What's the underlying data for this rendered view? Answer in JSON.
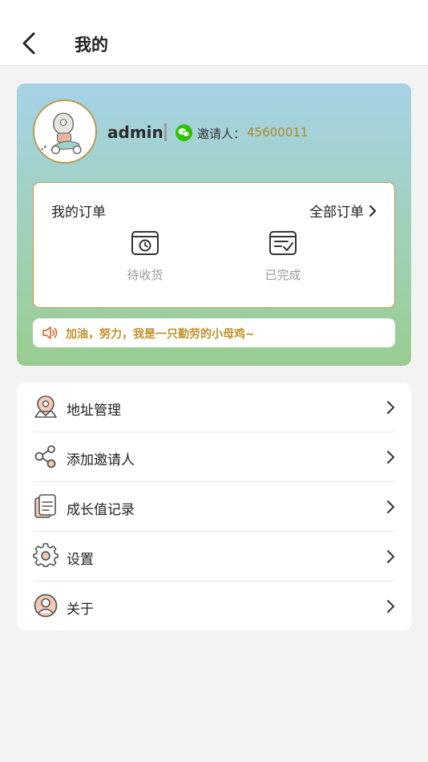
{
  "header": {
    "title": "我的"
  },
  "profile": {
    "username": "admin",
    "inviter_label": "邀请人：",
    "inviter_id": "45600011"
  },
  "orders": {
    "title": "我的订单",
    "all_label": "全部订单",
    "items": [
      {
        "label": "待收货",
        "icon": "package-clock-icon"
      },
      {
        "label": "已完成",
        "icon": "completed-list-icon"
      }
    ]
  },
  "notice": {
    "text": "加油，努力，我是一只勤劳的小母鸡~"
  },
  "menu": {
    "items": [
      {
        "label": "地址管理",
        "icon": "location-pin-icon"
      },
      {
        "label": "添加邀请人",
        "icon": "share-icon"
      },
      {
        "label": "成长值记录",
        "icon": "document-icon"
      },
      {
        "label": "设置",
        "icon": "gear-icon"
      },
      {
        "label": "关于",
        "icon": "user-circle-icon"
      }
    ]
  },
  "colors": {
    "accent_gold": "#b99a52",
    "inviter_text": "#b3892a",
    "notice_text": "#c0902a",
    "gradient_top": "#a6d2e6",
    "gradient_bottom": "#99cd8f",
    "wechat_green": "#2dc100"
  }
}
